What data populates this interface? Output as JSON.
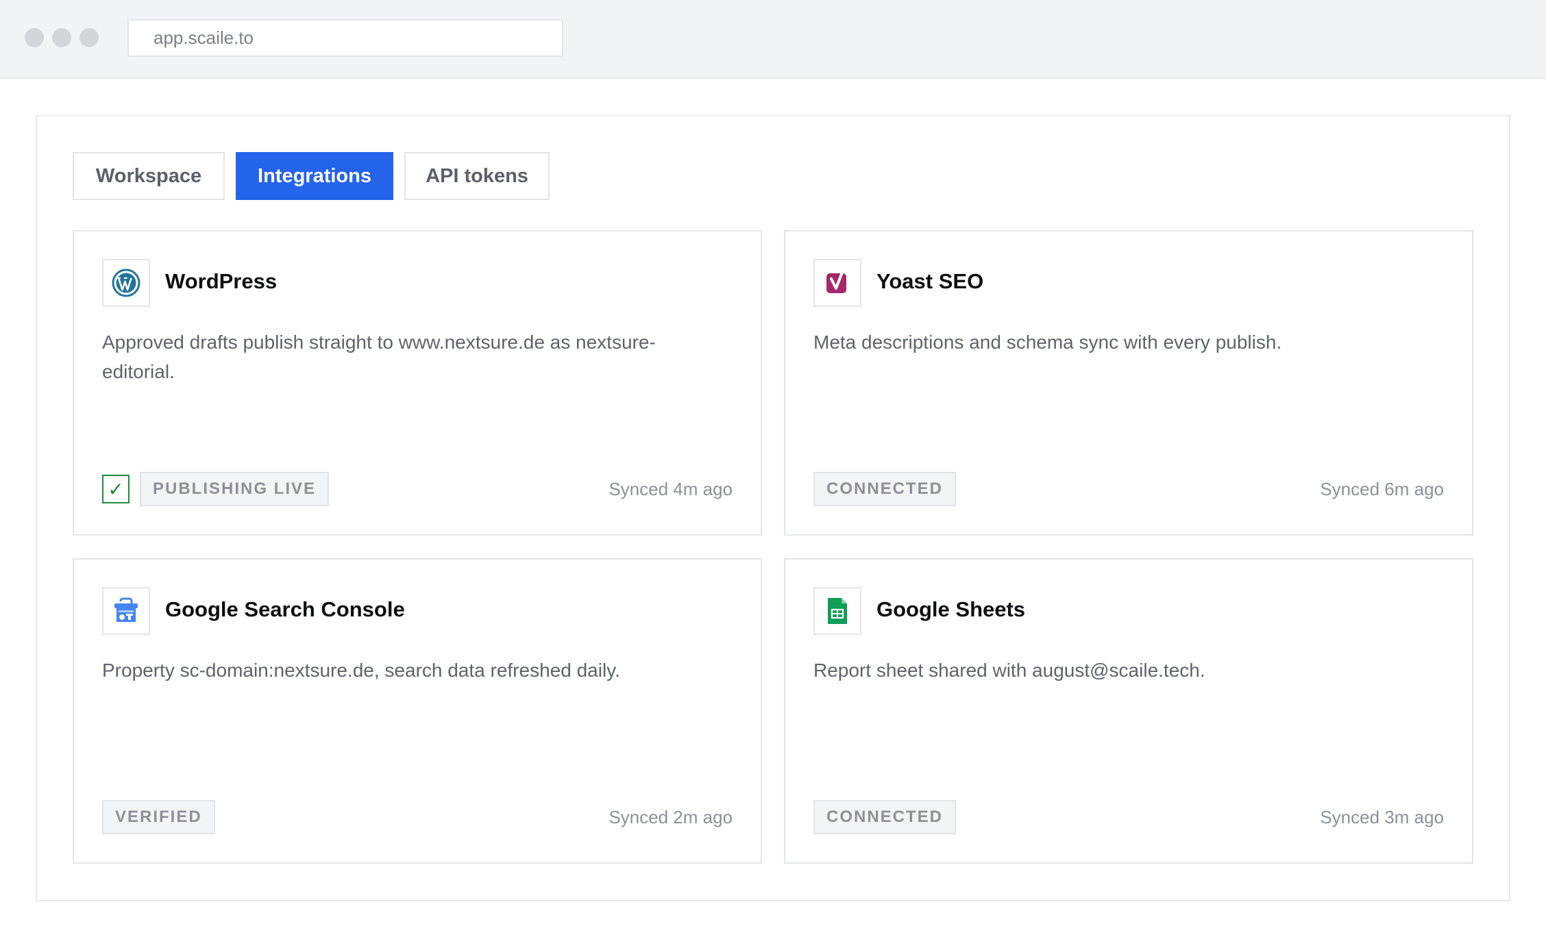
{
  "browser": {
    "url": "app.scaile.to"
  },
  "tabs": [
    {
      "label": "Workspace",
      "active": false
    },
    {
      "label": "Integrations",
      "active": true
    },
    {
      "label": "API tokens",
      "active": false
    }
  ],
  "colors": {
    "accent": "#2563eb",
    "success": "#1f8a3b",
    "wordpress": "#21759b",
    "yoast": "#a4286a",
    "gsc": "#4285f4",
    "sheets": "#0f9d58"
  },
  "integrations": [
    {
      "name": "WordPress",
      "icon": "wordpress-icon",
      "description": "Approved drafts publish straight to www.nextsure.de as nextsure-editorial.",
      "check": "✓",
      "status": "PUBLISHING LIVE",
      "synced": "Synced 4m ago"
    },
    {
      "name": "Yoast SEO",
      "icon": "yoast-icon",
      "description": "Meta descriptions and schema sync with every publish.",
      "status": "CONNECTED",
      "synced": "Synced 6m ago"
    },
    {
      "name": "Google Search Console",
      "icon": "search-console-icon",
      "description": "Property sc-domain:nextsure.de, search data refreshed daily.",
      "status": "VERIFIED",
      "synced": "Synced 2m ago"
    },
    {
      "name": "Google Sheets",
      "icon": "sheets-icon",
      "description": "Report sheet shared with august@scaile.tech.",
      "status": "CONNECTED",
      "synced": "Synced 3m ago"
    }
  ]
}
